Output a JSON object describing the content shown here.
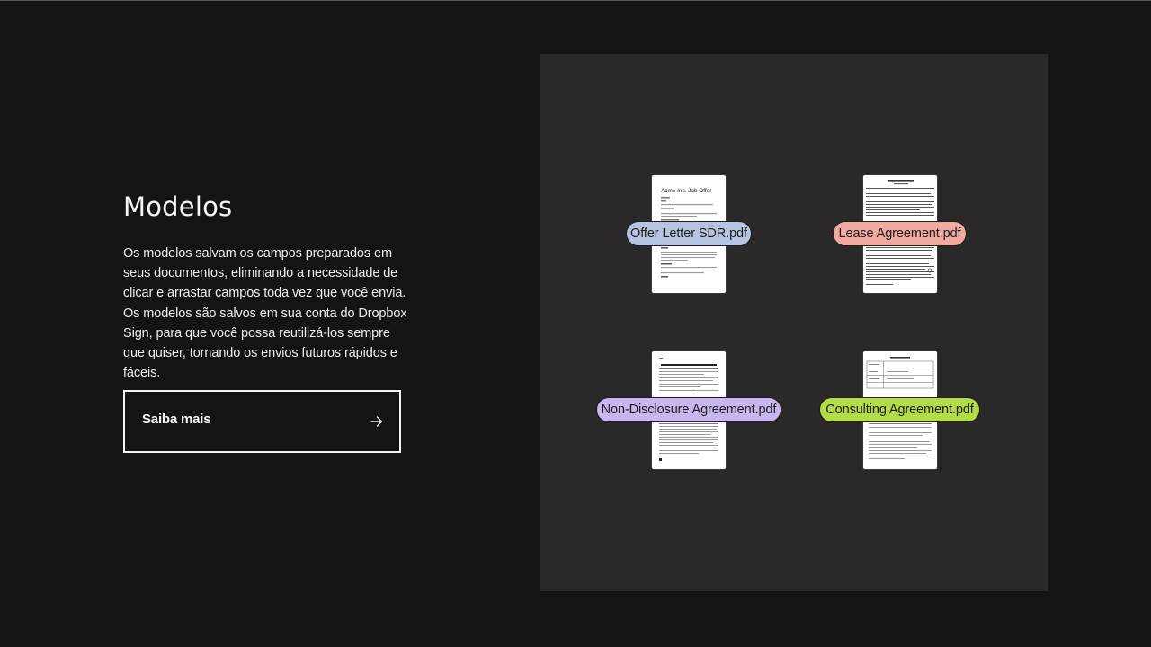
{
  "section": {
    "title": "Modelos",
    "description": "Os modelos salvam os campos preparados em seus documentos, eliminando a necessidade de clicar e arrastar campos toda vez que você envia. Os modelos são salvos em sua conta do Dropbox Sign, para que você possa reutilizá-los sempre que quiser, tornando os envios futuros rápidos e fáceis.",
    "cta_label": "Saiba mais",
    "cta_icon": "arrow-right-icon"
  },
  "templates": [
    {
      "file_name": "Offer Letter SDR.pdf",
      "color": "#b6c4e2",
      "preview_heading": "Acme Inc. Job Offer"
    },
    {
      "file_name": "Lease Agreement.pdf",
      "color": "#f1a9a0"
    },
    {
      "file_name": "Non-Disclosure Agreement.pdf",
      "color": "#c8b6ee"
    },
    {
      "file_name": "Consulting Agreement.pdf",
      "color": "#b4dc46"
    }
  ],
  "colors": {
    "background": "#151314",
    "panel": "#2a2829",
    "text": "#f7f5f2"
  }
}
